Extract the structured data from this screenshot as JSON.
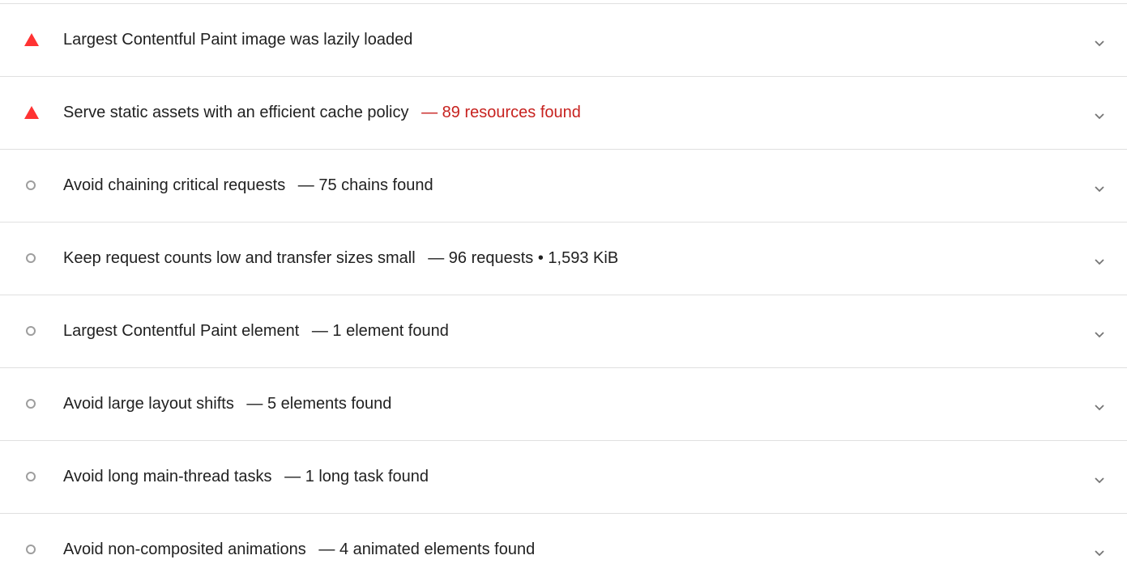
{
  "colors": {
    "fail": "#f33",
    "fail_text": "#c7221f",
    "info": "#9e9e9e",
    "text": "#212121",
    "divider": "#e0e0e0"
  },
  "audits": [
    {
      "status": "fail",
      "status_icon": "red-triangle-icon",
      "title": "Largest Contentful Paint image was lazily loaded",
      "separator": "",
      "display_value": "",
      "display_emphasis": false
    },
    {
      "status": "fail",
      "status_icon": "red-triangle-icon",
      "title": "Serve static assets with an efficient cache policy",
      "separator": "—",
      "display_value": "89 resources found",
      "display_emphasis": true
    },
    {
      "status": "info",
      "status_icon": "gray-circle-icon",
      "title": "Avoid chaining critical requests",
      "separator": "—",
      "display_value": "75 chains found",
      "display_emphasis": false
    },
    {
      "status": "info",
      "status_icon": "gray-circle-icon",
      "title": "Keep request counts low and transfer sizes small",
      "separator": "—",
      "display_value": "96 requests • 1,593 KiB",
      "display_emphasis": false
    },
    {
      "status": "info",
      "status_icon": "gray-circle-icon",
      "title": "Largest Contentful Paint element",
      "separator": "—",
      "display_value": "1 element found",
      "display_emphasis": false
    },
    {
      "status": "info",
      "status_icon": "gray-circle-icon",
      "title": "Avoid large layout shifts",
      "separator": "—",
      "display_value": "5 elements found",
      "display_emphasis": false
    },
    {
      "status": "info",
      "status_icon": "gray-circle-icon",
      "title": "Avoid long main-thread tasks",
      "separator": "—",
      "display_value": "1 long task found",
      "display_emphasis": false
    },
    {
      "status": "info",
      "status_icon": "gray-circle-icon",
      "title": "Avoid non-composited animations",
      "separator": "—",
      "display_value": "4 animated elements found",
      "display_emphasis": false
    }
  ]
}
